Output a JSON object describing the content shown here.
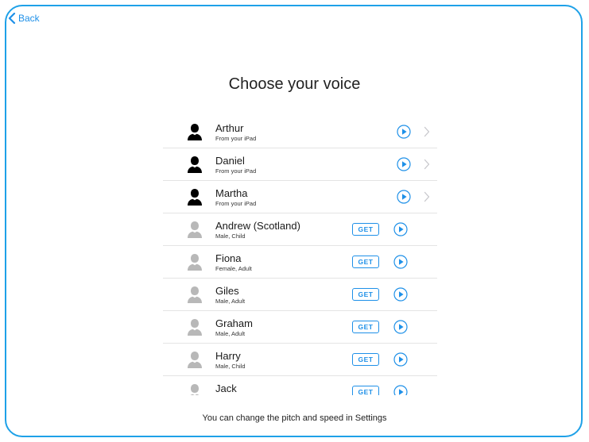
{
  "nav": {
    "back_label": "Back"
  },
  "page": {
    "title": "Choose your voice"
  },
  "voices": [
    {
      "name": "Arthur",
      "detail": "From your iPad",
      "installed": true
    },
    {
      "name": "Daniel",
      "detail": "From your iPad",
      "installed": true
    },
    {
      "name": "Martha",
      "detail": "From your iPad",
      "installed": true
    },
    {
      "name": "Andrew (Scotland)",
      "detail": "Male, Child",
      "installed": false,
      "get_label": "GET"
    },
    {
      "name": "Fiona",
      "detail": "Female, Adult",
      "installed": false,
      "get_label": "GET"
    },
    {
      "name": "Giles",
      "detail": "Male, Adult",
      "installed": false,
      "get_label": "GET"
    },
    {
      "name": "Graham",
      "detail": "Male, Adult",
      "installed": false,
      "get_label": "GET"
    },
    {
      "name": "Harry",
      "detail": "Male, Child",
      "installed": false,
      "get_label": "GET"
    },
    {
      "name": "Jack",
      "detail": "",
      "installed": false,
      "get_label": "GET"
    }
  ],
  "footer": {
    "note": "You can change the pitch and speed in Settings"
  },
  "colors": {
    "accent": "#1e90e8",
    "frame": "#1ea1e8",
    "installed_avatar": "#000000",
    "available_avatar": "#b8b8b8",
    "chevron": "#c7c7cc"
  },
  "icons": {
    "back": "chevron-left-icon",
    "avatar": "person-icon",
    "play": "play-circle-icon",
    "disclosure": "chevron-right-icon"
  }
}
